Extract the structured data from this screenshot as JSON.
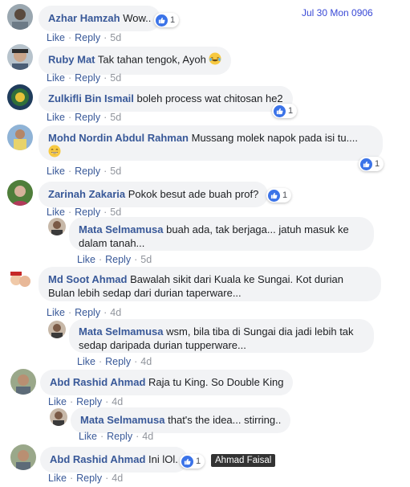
{
  "timestamp": "Jul 30 Mon 0906",
  "actions": {
    "like": "Like",
    "reply": "Reply",
    "sep": "·"
  },
  "colors": {
    "link": "#385898",
    "bubble": "#f2f3f5",
    "like_blue": "#3b73e8",
    "stamp": "#3949d6"
  },
  "tooltip": "Ahmad Faisal",
  "comments": [
    {
      "author": "Azhar Hamzah",
      "text": "Wow..",
      "time": "5d",
      "reactions": "1"
    },
    {
      "author": "Ruby Mat",
      "text": "Tak tahan tengok, Ayoh",
      "emoji": "laughing-crying",
      "time": "5d"
    },
    {
      "author": "Zulkifli Bin Ismail",
      "text": "boleh process wat chitosan he2",
      "time": "5d",
      "reactions": "1"
    },
    {
      "author": "Mohd Nordin Abdul Rahman",
      "text": "Mussang molek napok pada isi tu....",
      "emoji": "grinning",
      "time": "5d",
      "reactions": "1"
    },
    {
      "author": "Zarinah Zakaria",
      "text": "Pokok besut ade buah prof?",
      "time": "5d",
      "reactions": "1"
    },
    {
      "author": "Mata Selmamusa",
      "text_line1": "buah ada, tak berjaga... jatuh masuk ke",
      "text_line2": "dalam tanah...",
      "time": "5d",
      "reply": true
    },
    {
      "author": "Md Soot Ahmad",
      "text_line1": "Bawalah sikit dari Kuala ke Sungai. Kot durian",
      "text_line2": "Bulan lebih sedap dari durian taperware...",
      "time": "4d"
    },
    {
      "author": "Mata Selmamusa",
      "text_line1": "wsm, bila tiba di Sungai dia jadi lebih tak",
      "text_line2": "sedap daripada durian tupperware...",
      "time": "4d",
      "reply": true
    },
    {
      "author": "Abd Rashid Ahmad",
      "text": "Raja tu King. So Double King",
      "time": "4d"
    },
    {
      "author": "Mata Selmamusa",
      "text": "that's the idea... stirring..",
      "time": "4d",
      "reply": true
    },
    {
      "author": "Abd Rashid Ahmad",
      "text": "Ini lOl.",
      "time": "4d",
      "reactions": "1"
    }
  ]
}
